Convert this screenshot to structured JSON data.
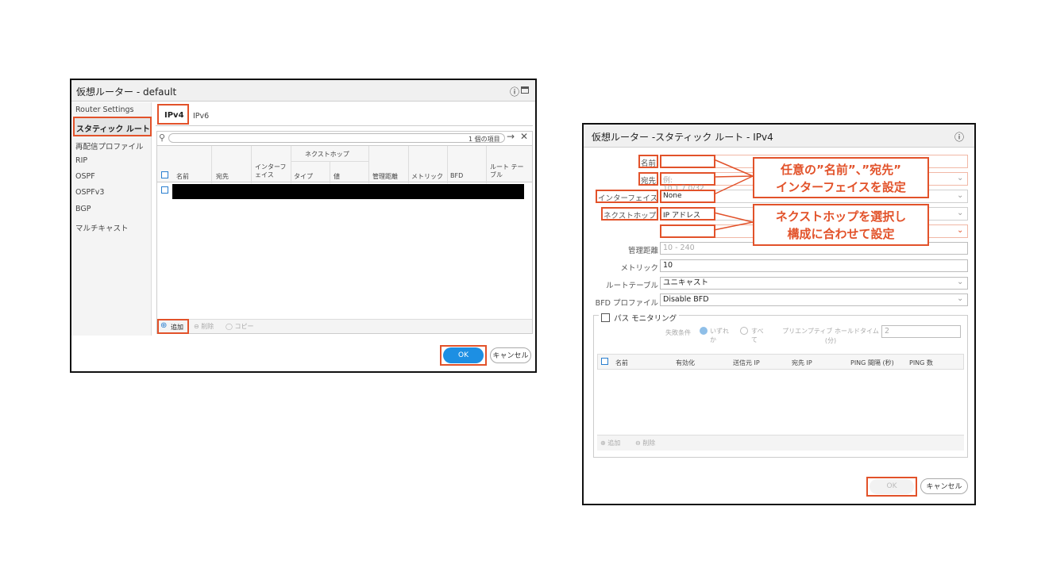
{
  "left_dialog": {
    "title": "仮想ルーター - default",
    "sidebar": [
      "Router Settings",
      "スタティック ルート",
      "再配信プロファイル",
      "RIP",
      "OSPF",
      "OSPFv3",
      "BGP",
      "マルチキャスト"
    ],
    "tabs": [
      "IPv4",
      "IPv6"
    ],
    "item_count": "1 個の項目",
    "table": {
      "group_header": "ネクストホップ",
      "columns": [
        "名前",
        "宛先",
        "インターフェイス",
        "タイプ",
        "値",
        "管理距離",
        "メトリック",
        "BFD",
        "ルート テーブル"
      ]
    },
    "footer": {
      "add": "追加",
      "delete": "削除",
      "copy": "コピー"
    },
    "ok": "OK",
    "cancel": "キャンセル"
  },
  "right_dialog": {
    "title": "仮想ルーター -スタティック ルート - IPv4",
    "fields": {
      "name_label": "名前",
      "dest_label": "宛先",
      "dest_placeholder": "例: 10.1.7.0/32",
      "iface_label": "インターフェイス",
      "iface_value": "None",
      "nexthop_label": "ネクストホップ",
      "nexthop_value": "IP アドレス",
      "admin_label": "管理距離",
      "admin_placeholder": "10 - 240",
      "metric_label": "メトリック",
      "metric_value": "10",
      "route_table_label": "ルートテーブル",
      "route_table_value": "ユニキャスト",
      "bfd_label": "BFD プロファイル",
      "bfd_value": "Disable BFD"
    },
    "path_monitoring": {
      "title": "パス モニタリング",
      "fail_condition_label": "失敗条件",
      "option_any": "いずれか",
      "option_all": "すべて",
      "preemptive_label": "プリエンプティブ ホールドタイム (分)",
      "preemptive_value": "2",
      "columns": [
        "名前",
        "有効化",
        "送信元 IP",
        "宛先 IP",
        "PING 間隔 (秒)",
        "PING 数"
      ],
      "add": "追加",
      "delete": "削除"
    },
    "ok": "OK",
    "cancel": "キャンセル"
  },
  "callouts": {
    "c1_line1": "任意の”名前”、”宛先”",
    "c1_line2": "インターフェイスを設定",
    "c2_line1": "ネクストホップを選択し",
    "c2_line2": "構成に合わせて設定"
  },
  "colors": {
    "accent": "#e2522a",
    "ok_blue": "#1d8fe3",
    "checkbox": "#2a7fd0"
  }
}
